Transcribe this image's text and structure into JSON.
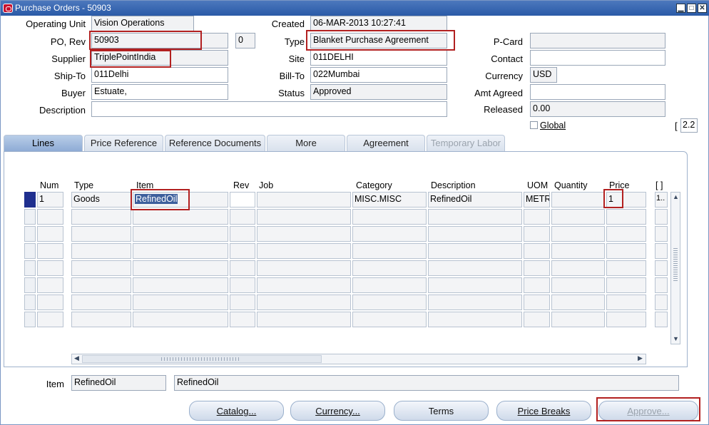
{
  "window": {
    "title": "Purchase Orders - 50903"
  },
  "header": {
    "operating_unit_label": "Operating Unit",
    "operating_unit": "Vision Operations",
    "created_label": "Created",
    "created": "06-MAR-2013 10:27:41",
    "po_rev_label": "PO, Rev",
    "po_number": "50903",
    "rev": "0",
    "type_label": "Type",
    "type": "Blanket Purchase Agreement",
    "pcard_label": "P-Card",
    "pcard": "",
    "supplier_label": "Supplier",
    "supplier": "TriplePointIndia",
    "site_label": "Site",
    "site": "011DELHI",
    "contact_label": "Contact",
    "contact": "",
    "shipto_label": "Ship-To",
    "shipto": "011Delhi",
    "billto_label": "Bill-To",
    "billto": "022Mumbai",
    "currency_label": "Currency",
    "currency": "USD",
    "buyer_label": "Buyer",
    "buyer": "Estuate,",
    "status_label": "Status",
    "status": "Approved",
    "amt_agreed_label": "Amt Agreed",
    "amt_agreed": "",
    "description_label": "Description",
    "description": "",
    "released_label": "Released",
    "released": "0.00",
    "global_label": "Global",
    "global_checked": false,
    "counter": "2.2",
    "counter_bracket_open": "["
  },
  "tabs": [
    {
      "label": "Lines"
    },
    {
      "label": "Price Reference"
    },
    {
      "label": "Reference Documents"
    },
    {
      "label": "More"
    },
    {
      "label": "Agreement"
    },
    {
      "label": "Temporary Labor"
    }
  ],
  "lines": {
    "columns": {
      "num": "Num",
      "type": "Type",
      "item": "Item",
      "rev": "Rev",
      "job": "Job",
      "category": "Category",
      "description": "Description",
      "uom": "UOM",
      "quantity": "Quantity",
      "price": "Price",
      "extra": "[ ]"
    },
    "rows": [
      {
        "num": "1",
        "type": "Goods",
        "item": "RefinedOil",
        "rev": "",
        "job": "",
        "category": "MISC.MISC",
        "description": "RefinedOil",
        "uom": "METR",
        "quantity": "",
        "price": "1",
        "extra": "1.."
      }
    ]
  },
  "footer": {
    "item_label": "Item",
    "item": "RefinedOil",
    "item_description": "RefinedOil"
  },
  "buttons": {
    "catalog": "Catalog...",
    "currency": "Currency...",
    "terms": "Terms",
    "price_breaks": "Price Breaks",
    "approve": "Approve..."
  },
  "colors": {
    "highlight_box": "#b22020",
    "title_bar": "#2a5aa7",
    "required_field": "#fceeb5"
  }
}
